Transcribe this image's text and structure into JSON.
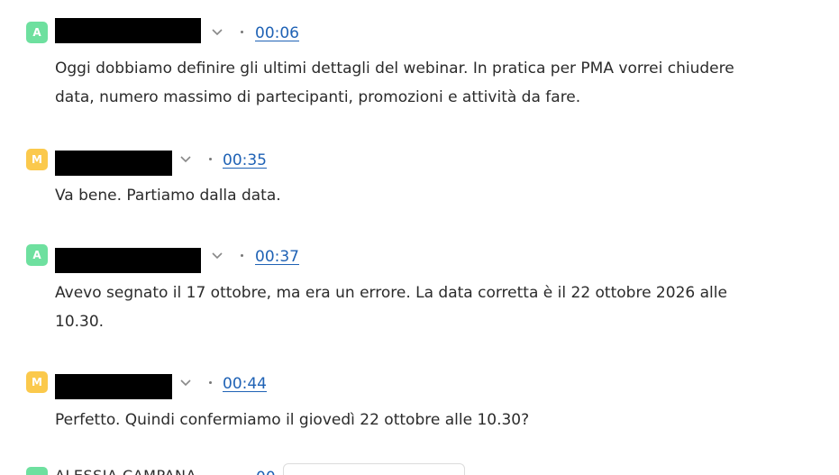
{
  "colors": {
    "avatar_a": "#6ee09f",
    "avatar_m": "#fbc94c",
    "timestamp_link": "#1f62b5"
  },
  "entries": [
    {
      "avatar": "A",
      "speaker_redacted": true,
      "time": "00:06",
      "text": "Oggi dobbiamo definire gli ultimi dettagli del webinar. In pratica per PMA vorrei chiudere data, numero massimo di partecipanti, promozioni e attività da fare."
    },
    {
      "avatar": "M",
      "speaker_redacted": true,
      "time": "00:35",
      "text": "Va bene. Partiamo dalla data."
    },
    {
      "avatar": "A",
      "speaker_redacted": true,
      "time": "00:37",
      "text": "Avevo segnato il 17 ottobre, ma era un errore. La data corretta è il 22 ottobre 2026 alle 10.30."
    },
    {
      "avatar": "M",
      "speaker_redacted": true,
      "time": "00:44",
      "text": "Perfetto. Quindi confermiamo il giovedì 22 ottobre alle 10.30?"
    }
  ],
  "partial_entry": {
    "name": "ALESSIA CAMPANA",
    "time_fragment": "00"
  }
}
